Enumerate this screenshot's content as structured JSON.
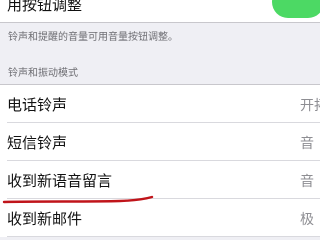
{
  "top_setting": {
    "label": "用按钮调整",
    "toggle_on": true,
    "toggle_color": "#4cd964"
  },
  "footer_note": "铃声和提醒的音量可用音量按钮调整。",
  "section": {
    "header": "铃声和振动模式",
    "rows": [
      {
        "label": "电话铃声",
        "value": "开拓"
      },
      {
        "label": "短信铃声",
        "value": "音"
      },
      {
        "label": "收到新语音留言",
        "value": "音"
      },
      {
        "label": "收到新邮件",
        "value": "极"
      }
    ]
  },
  "annotation_color": "#c0141a"
}
